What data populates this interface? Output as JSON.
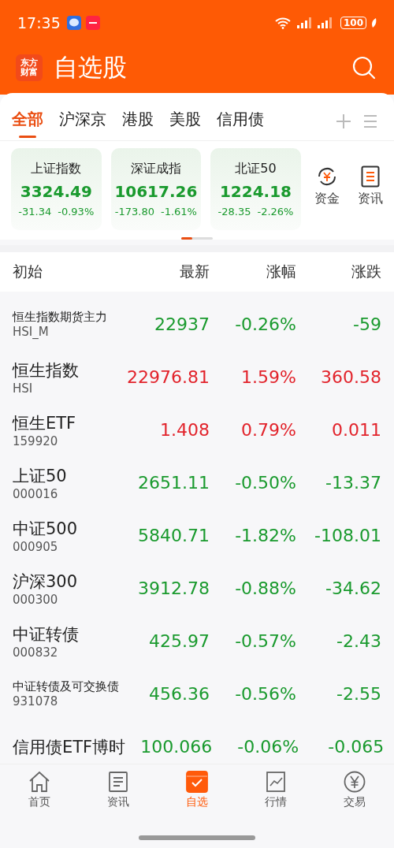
{
  "status_bar": {
    "time": "17:35",
    "battery": "100"
  },
  "header": {
    "logo": [
      "东方",
      "财富"
    ],
    "title": "自选股"
  },
  "tabs": [
    {
      "label": "全部",
      "selected": true
    },
    {
      "label": "沪深京",
      "selected": false
    },
    {
      "label": "港股",
      "selected": false
    },
    {
      "label": "美股",
      "selected": false
    },
    {
      "label": "信用债",
      "selected": false
    }
  ],
  "indices": [
    {
      "name": "上证指数",
      "value": "3324.49",
      "change": "-31.34",
      "percent": "-0.93%",
      "rise": false
    },
    {
      "name": "深证成指",
      "value": "10617.26",
      "change": "-173.80",
      "percent": "-1.61%",
      "rise": false
    },
    {
      "name": "北证50",
      "value": "1224.18",
      "change": "-28.35",
      "percent": "-2.26%",
      "rise": false
    }
  ],
  "shortcuts": [
    {
      "kind": "funds",
      "label": "资金"
    },
    {
      "kind": "news",
      "label": "资讯"
    }
  ],
  "table": {
    "columns": [
      "初始",
      "最新",
      "涨幅",
      "涨跌"
    ],
    "rows": [
      {
        "name": "恒生指数期货主力",
        "code": "HSI_M",
        "price": "22937",
        "percent": "-0.26%",
        "change": "-59",
        "rise": false
      },
      {
        "name": "恒生指数",
        "code": "HSI",
        "price": "22976.81",
        "percent": "1.59%",
        "change": "360.58",
        "rise": true
      },
      {
        "name": "恒生ETF",
        "code": "159920",
        "price": "1.408",
        "percent": "0.79%",
        "change": "0.011",
        "rise": true
      },
      {
        "name": "上证50",
        "code": "000016",
        "price": "2651.11",
        "percent": "-0.50%",
        "change": "-13.37",
        "rise": false
      },
      {
        "name": "中证500",
        "code": "000905",
        "price": "5840.71",
        "percent": "-1.82%",
        "change": "-108.01",
        "rise": false
      },
      {
        "name": "沪深300",
        "code": "000300",
        "price": "3912.78",
        "percent": "-0.88%",
        "change": "-34.62",
        "rise": false
      },
      {
        "name": "中证转债",
        "code": "000832",
        "price": "425.97",
        "percent": "-0.57%",
        "change": "-2.43",
        "rise": false
      },
      {
        "name": "中证转债及可交换债",
        "code": "931078",
        "price": "456.36",
        "percent": "-0.56%",
        "change": "-2.55",
        "rise": false
      },
      {
        "name": "信用债ETF博时",
        "price": "100.066",
        "percent": "-0.06%",
        "change": "-0.065",
        "rise": false
      }
    ]
  },
  "bottom_nav": [
    {
      "kind": "home",
      "label": "首页",
      "selected": false
    },
    {
      "kind": "news",
      "label": "资讯",
      "selected": false
    },
    {
      "kind": "watchlist",
      "label": "自选",
      "selected": true
    },
    {
      "kind": "market",
      "label": "行情",
      "selected": false
    },
    {
      "kind": "trade",
      "label": "交易",
      "selected": false
    }
  ]
}
